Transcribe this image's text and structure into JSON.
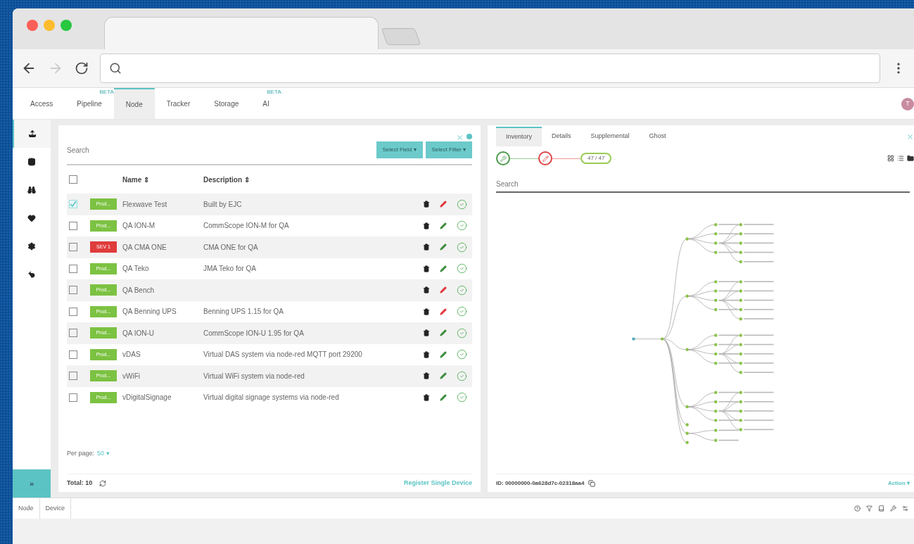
{
  "nav_tabs": [
    {
      "label": "Access",
      "selected": false
    },
    {
      "label": "Pipeline",
      "beta": "BETA",
      "selected": false
    },
    {
      "label": "Node",
      "selected": true
    },
    {
      "label": "Tracker",
      "selected": false
    },
    {
      "label": "Storage",
      "selected": false
    },
    {
      "label": "AI",
      "beta": "BETA",
      "selected": false
    }
  ],
  "avatar": "T",
  "sidebar": [
    {
      "selected": true
    },
    {
      "selected": false
    },
    {
      "selected": false
    },
    {
      "selected": false
    },
    {
      "selected": false
    },
    {
      "selected": false
    }
  ],
  "expand": "»",
  "left": {
    "search": {
      "placeholder": "Search"
    },
    "buttons": [
      "Select Field ▾",
      "Select Filter ▾"
    ],
    "columns": [
      "Name ⇕",
      "Description ⇕"
    ],
    "all_checked": false,
    "rows": [
      {
        "checked": true,
        "badge": {
          "text": "Prod...",
          "color": "#7cc242"
        },
        "name": "Flexwave Test",
        "description": "Built by EJC",
        "pencil": {
          "color": "#e0343a"
        }
      },
      {
        "checked": false,
        "badge": {
          "text": "Prod...",
          "color": "#7cc242"
        },
        "name": "QA ION-M",
        "description": "CommScope ION-M for QA",
        "pencil": {
          "color": "#3a8a3a"
        }
      },
      {
        "checked": false,
        "badge": {
          "text": "SEV 1",
          "color": "#e03c3c"
        },
        "name": "QA CMA ONE",
        "description": "CMA ONE for QA",
        "pencil": {
          "color": "#3a8a3a"
        }
      },
      {
        "checked": false,
        "badge": {
          "text": "Prod...",
          "color": "#7cc242"
        },
        "name": "QA Teko",
        "description": "JMA Teko for QA",
        "pencil": {
          "color": "#3a8a3a"
        }
      },
      {
        "checked": false,
        "badge": {
          "text": "Prod...",
          "color": "#7cc242"
        },
        "name": "QA Bench",
        "pencil": {
          "color": "#e0343a"
        }
      },
      {
        "checked": false,
        "badge": {
          "text": "Prod...",
          "color": "#7cc242"
        },
        "name": "QA Benning UPS",
        "description": "Benning UPS 1.15 for QA",
        "pencil": {
          "color": "#e0343a"
        }
      },
      {
        "checked": false,
        "badge": {
          "text": "Prod...",
          "color": "#7cc242"
        },
        "name": "QA ION-U",
        "description": "CommScope ION-U 1.95 for QA",
        "pencil": {
          "color": "#3a8a3a"
        }
      },
      {
        "checked": false,
        "badge": {
          "text": "Prod...",
          "color": "#7cc242"
        },
        "name": "vDAS",
        "description": "Virtual DAS system via node-red MQTT port 29200",
        "pencil": {
          "color": "#3a8a3a"
        }
      },
      {
        "checked": false,
        "badge": {
          "text": "Prod...",
          "color": "#7cc242"
        },
        "name": "vWiFi",
        "description": "Virtual WiFi system via node-red",
        "pencil": {
          "color": "#3a8a3a"
        }
      },
      {
        "checked": false,
        "badge": {
          "text": "Prod...",
          "color": "#7cc242"
        },
        "name": "vDigitalSignage",
        "description": "Virtual digital signage systems via node-red",
        "pencil": {
          "color": "#3a8a3a"
        }
      }
    ],
    "per_page_label": "Per page:",
    "per_page": "50 ▾",
    "total": "Total: 10",
    "register": "Register Single Device"
  },
  "right": {
    "tabs": [
      {
        "label": "Inventory",
        "selected": true
      },
      {
        "label": "Details",
        "selected": false
      },
      {
        "label": "Supplemental",
        "selected": false
      },
      {
        "label": "Ghost",
        "selected": false
      }
    ],
    "count": "47 / 47",
    "search": {
      "placeholder": "Search"
    },
    "id": "ID: 00000000-0a628d7c-02318aa4",
    "action": "Action ▾"
  },
  "breadcrumbs": [
    "Node",
    "Device"
  ]
}
